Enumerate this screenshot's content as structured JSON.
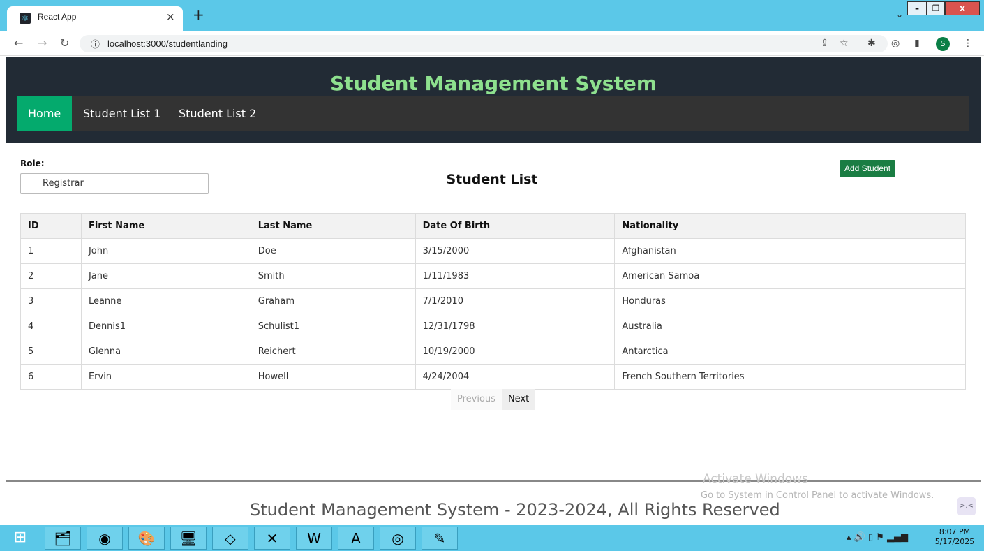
{
  "browser": {
    "tab_title": "React App",
    "tab_favicon": "⚛",
    "tab_close": "×",
    "new_tab": "+",
    "url": "localhost:3000/studentlanding",
    "window_controls": {
      "minimize": "–",
      "maximize": "❐",
      "close": "x"
    }
  },
  "app": {
    "title": "Student Management System",
    "nav": [
      {
        "label": "Home",
        "active": true
      },
      {
        "label": "Student List 1",
        "active": false
      },
      {
        "label": "Student List 2",
        "active": false
      }
    ],
    "role_label": "Role:",
    "role_value": "Registrar",
    "list_title": "Student List",
    "add_button": "Add Student",
    "table": {
      "headers": [
        "ID",
        "First Name",
        "Last Name",
        "Date Of Birth",
        "Nationality"
      ],
      "rows": [
        [
          "1",
          "John",
          "Doe",
          "3/15/2000",
          "Afghanistan"
        ],
        [
          "2",
          "Jane",
          "Smith",
          "1/11/1983",
          "American Samoa"
        ],
        [
          "3",
          "Leanne",
          "Graham",
          "7/1/2010",
          "Honduras"
        ],
        [
          "4",
          "Dennis1",
          "Schulist1",
          "12/31/1798",
          "Australia"
        ],
        [
          "5",
          "Glenna",
          "Reichert",
          "10/19/2000",
          "Antarctica"
        ],
        [
          "6",
          "Ervin",
          "Howell",
          "4/24/2004",
          "French Southern Territories"
        ]
      ]
    },
    "pager": {
      "previous": "Previous",
      "next": "Next"
    },
    "footer": "Student Management System - 2023-2024, All Rights Reserved"
  },
  "watermark": {
    "line1": "Activate Windows",
    "line2": "Go to System in Control Panel to activate Windows."
  },
  "taskbar": {
    "start_icon": "windows-logo",
    "apps": [
      "file-explorer-icon",
      "chrome-icon",
      "paint-icon",
      "monitor-icon",
      "virtualbox-icon",
      "vscode-icon",
      "word-icon",
      "acrobat-icon",
      "media-icon",
      "notepad-icon"
    ],
    "time": "8:07 PM",
    "date": "5/17/2025"
  },
  "colors": {
    "brand_green": "#04aa6d",
    "title_green": "#8ee08e",
    "header_bg": "#222b35",
    "add_button": "#1a7d43"
  }
}
